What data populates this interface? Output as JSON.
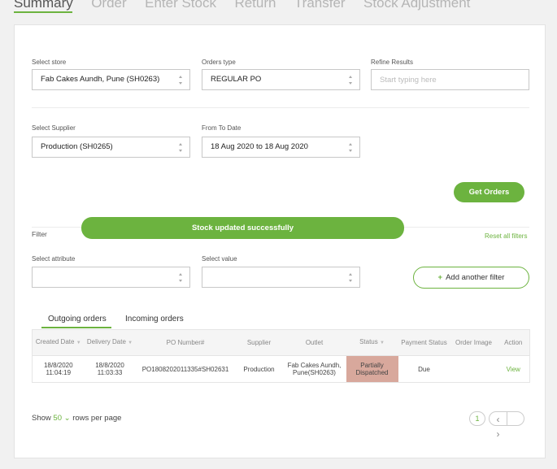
{
  "top_tabs": [
    {
      "label": "Summary"
    },
    {
      "label": "Order"
    },
    {
      "label": "Enter Stock"
    },
    {
      "label": "Return"
    },
    {
      "label": "Transfer"
    },
    {
      "label": "Stock Adjustment"
    }
  ],
  "filters": {
    "store_label": "Select store",
    "store_value": "Fab Cakes Aundh, Pune (SH0263)",
    "orders_type_label": "Orders type",
    "orders_type_value": "REGULAR PO",
    "refine_label": "Refine Results",
    "refine_placeholder": "Start typing here",
    "supplier_label": "Select Supplier",
    "supplier_value": "Production (SH0265)",
    "date_label": "From To Date",
    "date_value": "18 Aug 2020 to 18 Aug 2020",
    "get_orders_label": "Get Orders"
  },
  "filter_section": {
    "title": "Filter",
    "toast": "Stock updated successfully",
    "reset_label": "Reset all filters",
    "attribute_label": "Select attribute",
    "value_label": "Select value",
    "add_filter_label": "Add another filter"
  },
  "order_tabs": [
    {
      "label": "Outgoing orders"
    },
    {
      "label": "Incoming orders"
    }
  ],
  "table": {
    "headers": {
      "created_date": "Created Date",
      "delivery_date": "Delivery Date",
      "po_number": "PO Number#",
      "supplier": "Supplier",
      "outlet": "Outlet",
      "status": "Status",
      "payment_status": "Payment Status",
      "order_image": "Order Image",
      "action": "Action"
    },
    "rows": [
      {
        "created_date": "18/8/2020 11:04:19",
        "delivery_date": "18/8/2020 11:03:33",
        "po_number": "PO1808202011335#SH02631",
        "supplier": "Production",
        "outlet": "Fab Cakes Aundh, Pune(SH0263)",
        "status": "Partially Dispatched",
        "payment_status": "Due",
        "order_image": "",
        "action": "View"
      }
    ]
  },
  "pagination": {
    "show_label": "Show",
    "rows_value": "50",
    "rows_suffix": "rows per page",
    "current_page": "1"
  },
  "colors": {
    "accent": "#6cb33f",
    "status_partial": "#d8a89c"
  }
}
